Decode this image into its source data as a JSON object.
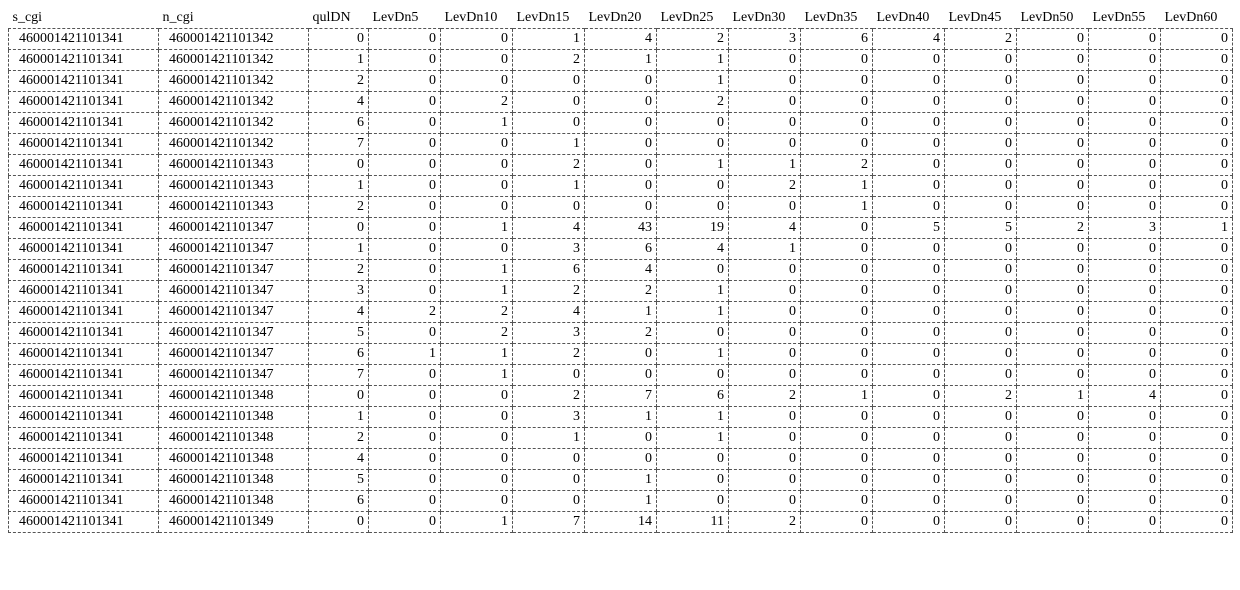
{
  "chart_data": {
    "type": "table",
    "columns": [
      "s_cgi",
      "n_cgi",
      "qulDN",
      "LevDn5",
      "LevDn10",
      "LevDn15",
      "LevDn20",
      "LevDn25",
      "LevDn30",
      "LevDn35",
      "LevDn40",
      "LevDn45",
      "LevDn50",
      "LevDn55",
      "LevDn60"
    ],
    "rows": [
      [
        "460001421101341",
        "460001421101342",
        0,
        0,
        0,
        1,
        4,
        2,
        3,
        6,
        4,
        2,
        0,
        0,
        0
      ],
      [
        "460001421101341",
        "460001421101342",
        1,
        0,
        0,
        2,
        1,
        1,
        0,
        0,
        0,
        0,
        0,
        0,
        0
      ],
      [
        "460001421101341",
        "460001421101342",
        2,
        0,
        0,
        0,
        0,
        1,
        0,
        0,
        0,
        0,
        0,
        0,
        0
      ],
      [
        "460001421101341",
        "460001421101342",
        4,
        0,
        2,
        0,
        0,
        2,
        0,
        0,
        0,
        0,
        0,
        0,
        0
      ],
      [
        "460001421101341",
        "460001421101342",
        6,
        0,
        1,
        0,
        0,
        0,
        0,
        0,
        0,
        0,
        0,
        0,
        0
      ],
      [
        "460001421101341",
        "460001421101342",
        7,
        0,
        0,
        1,
        0,
        0,
        0,
        0,
        0,
        0,
        0,
        0,
        0
      ],
      [
        "460001421101341",
        "460001421101343",
        0,
        0,
        0,
        2,
        0,
        1,
        1,
        2,
        0,
        0,
        0,
        0,
        0
      ],
      [
        "460001421101341",
        "460001421101343",
        1,
        0,
        0,
        1,
        0,
        0,
        2,
        1,
        0,
        0,
        0,
        0,
        0
      ],
      [
        "460001421101341",
        "460001421101343",
        2,
        0,
        0,
        0,
        0,
        0,
        0,
        1,
        0,
        0,
        0,
        0,
        0
      ],
      [
        "460001421101341",
        "460001421101347",
        0,
        0,
        1,
        4,
        43,
        19,
        4,
        0,
        5,
        5,
        2,
        3,
        1
      ],
      [
        "460001421101341",
        "460001421101347",
        1,
        0,
        0,
        3,
        6,
        4,
        1,
        0,
        0,
        0,
        0,
        0,
        0
      ],
      [
        "460001421101341",
        "460001421101347",
        2,
        0,
        1,
        6,
        4,
        0,
        0,
        0,
        0,
        0,
        0,
        0,
        0
      ],
      [
        "460001421101341",
        "460001421101347",
        3,
        0,
        1,
        2,
        2,
        1,
        0,
        0,
        0,
        0,
        0,
        0,
        0
      ],
      [
        "460001421101341",
        "460001421101347",
        4,
        2,
        2,
        4,
        1,
        1,
        0,
        0,
        0,
        0,
        0,
        0,
        0
      ],
      [
        "460001421101341",
        "460001421101347",
        5,
        0,
        2,
        3,
        2,
        0,
        0,
        0,
        0,
        0,
        0,
        0,
        0
      ],
      [
        "460001421101341",
        "460001421101347",
        6,
        1,
        1,
        2,
        0,
        1,
        0,
        0,
        0,
        0,
        0,
        0,
        0
      ],
      [
        "460001421101341",
        "460001421101347",
        7,
        0,
        1,
        0,
        0,
        0,
        0,
        0,
        0,
        0,
        0,
        0,
        0
      ],
      [
        "460001421101341",
        "460001421101348",
        0,
        0,
        0,
        2,
        7,
        6,
        2,
        1,
        0,
        2,
        1,
        4,
        0
      ],
      [
        "460001421101341",
        "460001421101348",
        1,
        0,
        0,
        3,
        1,
        1,
        0,
        0,
        0,
        0,
        0,
        0,
        0
      ],
      [
        "460001421101341",
        "460001421101348",
        2,
        0,
        0,
        1,
        0,
        1,
        0,
        0,
        0,
        0,
        0,
        0,
        0
      ],
      [
        "460001421101341",
        "460001421101348",
        4,
        0,
        0,
        0,
        0,
        0,
        0,
        0,
        0,
        0,
        0,
        0,
        0
      ],
      [
        "460001421101341",
        "460001421101348",
        5,
        0,
        0,
        0,
        1,
        0,
        0,
        0,
        0,
        0,
        0,
        0,
        0
      ],
      [
        "460001421101341",
        "460001421101348",
        6,
        0,
        0,
        0,
        1,
        0,
        0,
        0,
        0,
        0,
        0,
        0,
        0
      ],
      [
        "460001421101341",
        "460001421101349",
        0,
        0,
        1,
        7,
        14,
        11,
        2,
        0,
        0,
        0,
        0,
        0,
        0
      ]
    ]
  }
}
